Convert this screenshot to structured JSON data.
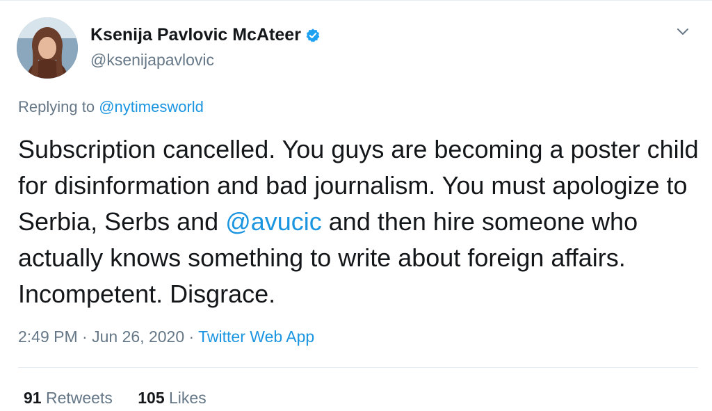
{
  "user": {
    "display_name": "Ksenija Pavlovic McAteer",
    "handle": "@ksenijapavlovic"
  },
  "reply": {
    "prefix": "Replying to",
    "to": "@nytimesworld"
  },
  "tweet": {
    "text_1": "Subscription cancelled. You guys are becoming a poster child for disinformation and bad journalism. You must apologize to Serbia, Serbs and ",
    "mention": "@avucic",
    "text_2": " and then hire someone who actually knows something to write about foreign affairs. Incompetent. Disgrace."
  },
  "meta": {
    "time": "2:49 PM",
    "separator1": " · ",
    "date": "Jun 26, 2020",
    "separator2": " · ",
    "source": "Twitter Web App"
  },
  "stats": {
    "retweets_count": "91",
    "retweets_label": "Retweets",
    "likes_count": "105",
    "likes_label": "Likes"
  },
  "colors": {
    "link": "#1b95e0",
    "verified": "#1da1f2"
  },
  "icons": {
    "verified": "verified-badge-icon",
    "caret": "chevron-down-icon"
  }
}
